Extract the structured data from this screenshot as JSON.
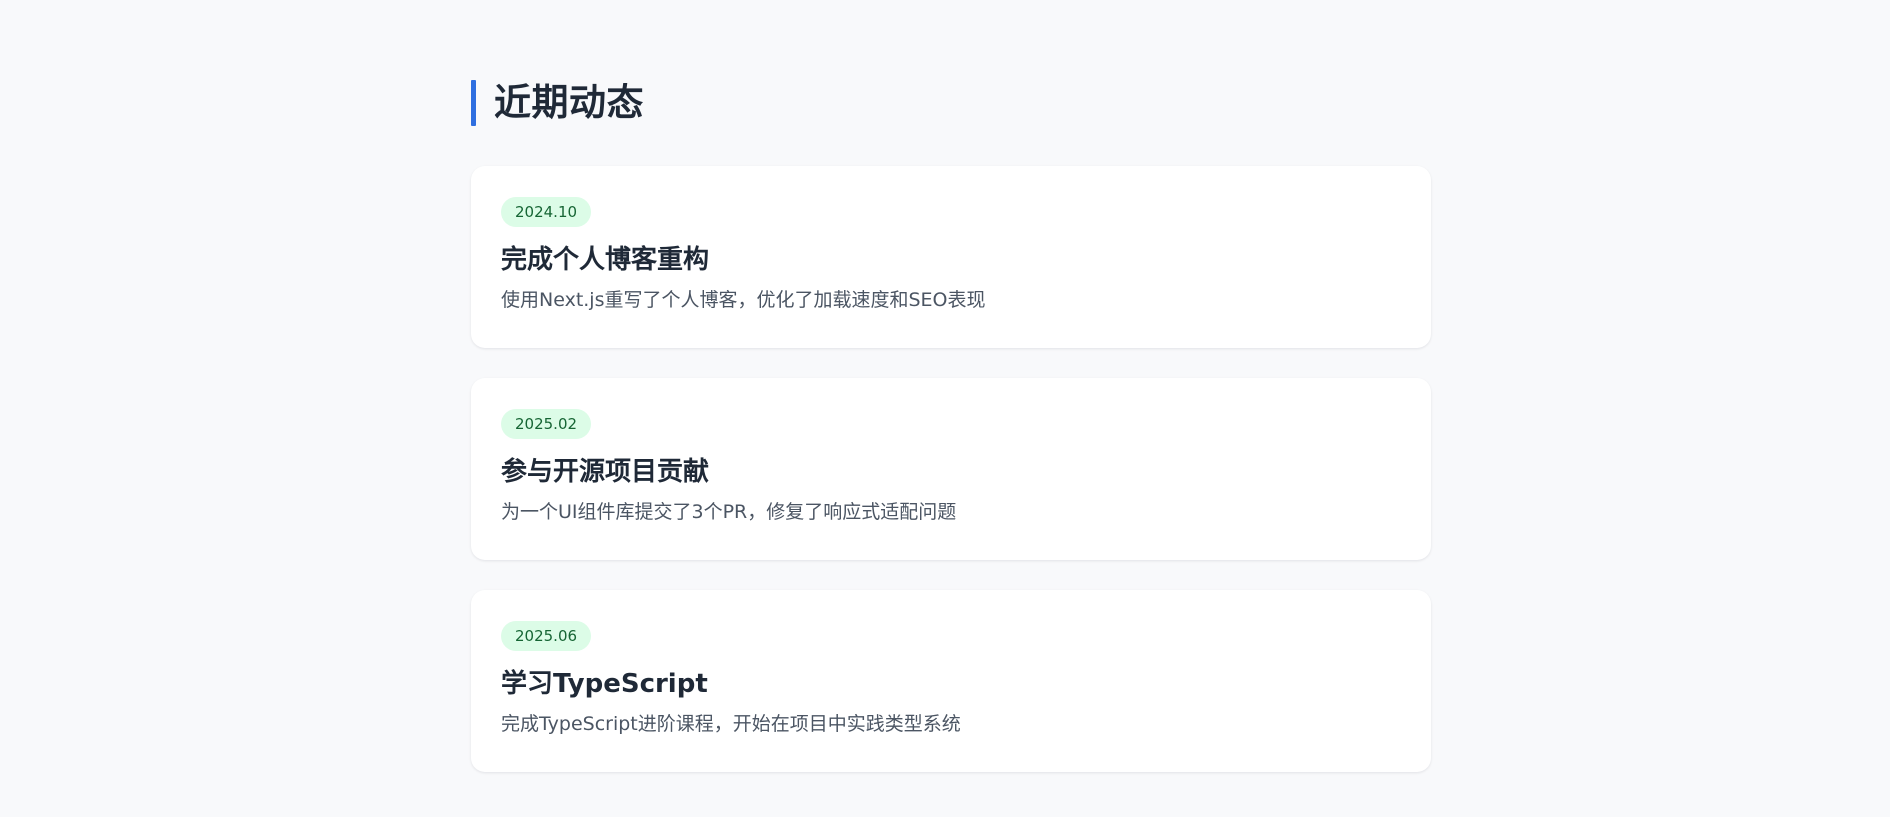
{
  "section": {
    "title": "近期动态"
  },
  "timeline": [
    {
      "date": "2024.10",
      "title": "完成个人博客重构",
      "description": "使用Next.js重写了个人博客，优化了加载速度和SEO表现"
    },
    {
      "date": "2025.02",
      "title": "参与开源项目贡献",
      "description": "为一个UI组件库提交了3个PR，修复了响应式适配问题"
    },
    {
      "date": "2025.06",
      "title": "学习TypeScript",
      "description": "完成TypeScript进阶课程，开始在项目中实践类型系统"
    }
  ],
  "colors": {
    "accent": "#2f6fe0",
    "badge_bg": "#dcfce7",
    "badge_text": "#166534",
    "page_bg": "#f8f9fb"
  }
}
